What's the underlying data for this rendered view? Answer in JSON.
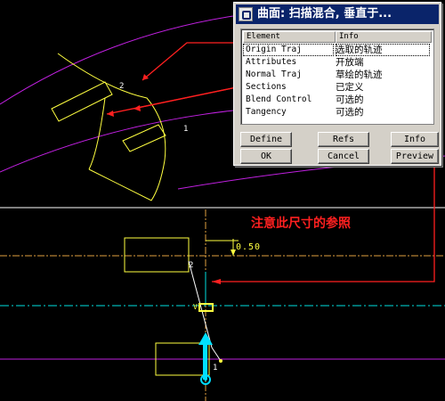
{
  "dialog": {
    "title": "曲面: 扫描混合, 垂直于...",
    "columns": [
      "Element",
      "Info"
    ],
    "rows": [
      {
        "element": "Origin Traj",
        "info": "选取的轨迹"
      },
      {
        "element": "Attributes",
        "info": "开放端"
      },
      {
        "element": "Normal Traj",
        "info": "草绘的轨迹"
      },
      {
        "element": "Sections",
        "info": "已定义"
      },
      {
        "element": "Blend Control",
        "info": "可选的"
      },
      {
        "element": "Tangency",
        "info": "可选的"
      }
    ],
    "buttons": {
      "define": "Define",
      "refs": "Refs",
      "info": "Info",
      "ok": "OK",
      "cancel": "Cancel",
      "preview": "Preview"
    }
  },
  "annotation": {
    "note": "注意此尺寸的参照"
  },
  "model": {
    "label_2_top": "2",
    "label_1_top": "1",
    "label_2_bottom": "2",
    "label_1_bottom": "1",
    "label_v": "V",
    "dimension": "0.50"
  },
  "colors": {
    "background": "#000000",
    "trajectory": "#c020e0",
    "section": "#ffff40",
    "arrow": "#ff2020",
    "axis": "#00e0e0",
    "dialog_title": "#0a246a"
  }
}
